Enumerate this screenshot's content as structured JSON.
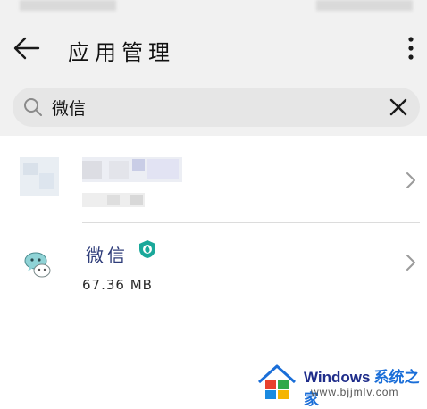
{
  "header": {
    "title": "应用管理",
    "back_icon": "arrow-left-icon",
    "more_icon": "more-vert-icon"
  },
  "search": {
    "value": "微信",
    "search_icon": "search-icon",
    "clear_icon": "close-icon"
  },
  "results": [
    {
      "name": "",
      "size": "",
      "blurred": true,
      "chevron_icon": "chevron-right-icon"
    },
    {
      "name": "微信",
      "size": "67.36 MB",
      "icon": "wechat-icon",
      "badge_icon": "verified-shield-icon",
      "badge_color": "#1aa89a",
      "chevron_icon": "chevron-right-icon"
    }
  ],
  "watermark": {
    "brand": "Windows",
    "brand_cn": "系统之家",
    "url": "www.bjjmlv.com"
  },
  "colors": {
    "header_bg": "#f1f1f1",
    "search_bg": "#e6e6e6",
    "app_name": "#2f3d7a"
  }
}
